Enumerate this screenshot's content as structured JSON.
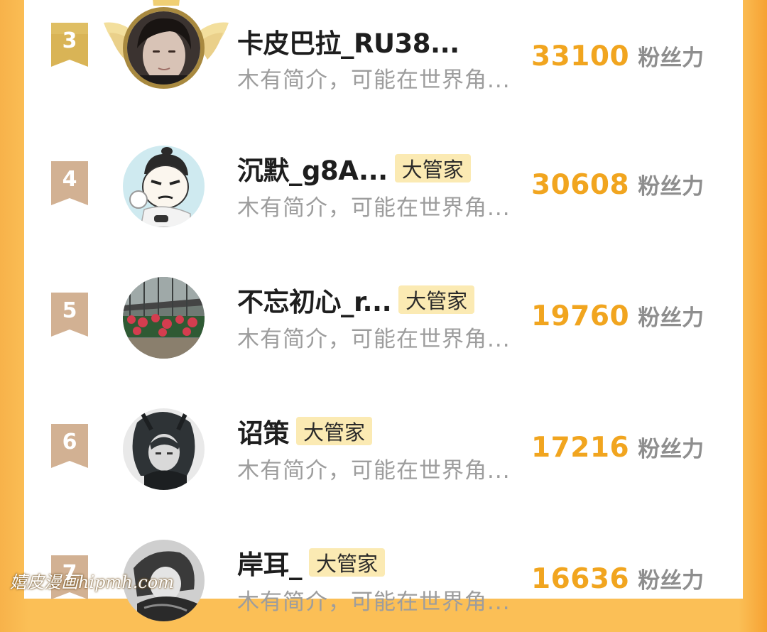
{
  "rows": [
    {
      "rank": "3",
      "name": "卡皮巴拉_RU38...",
      "badge": "",
      "bio": "木有简介，可能在世界角...",
      "fans": "33100",
      "unit": "粉丝力"
    },
    {
      "rank": "4",
      "name": "沉默_g8A...",
      "badge": "大管家",
      "bio": "木有简介，可能在世界角...",
      "fans": "30608",
      "unit": "粉丝力"
    },
    {
      "rank": "5",
      "name": "不忘初心_r...",
      "badge": "大管家",
      "bio": "木有简介，可能在世界角...",
      "fans": "19760",
      "unit": "粉丝力"
    },
    {
      "rank": "6",
      "name": "诏策",
      "badge": "大管家",
      "bio": "木有简介，可能在世界角...",
      "fans": "17216",
      "unit": "粉丝力"
    },
    {
      "rank": "7",
      "name": "岸耳_",
      "badge": "大管家",
      "bio": "木有简介，可能在世界角...",
      "fans": "16636",
      "unit": "粉丝力"
    }
  ],
  "watermark": "嬉皮漫画hipmh.com",
  "colors": {
    "fans_count": "#f1a51f",
    "badge_bg": "#fbeab3",
    "rank_bronze": "#cfa98a",
    "rank_gold": "#d6b15a",
    "side_orange": "#fbbf56"
  }
}
